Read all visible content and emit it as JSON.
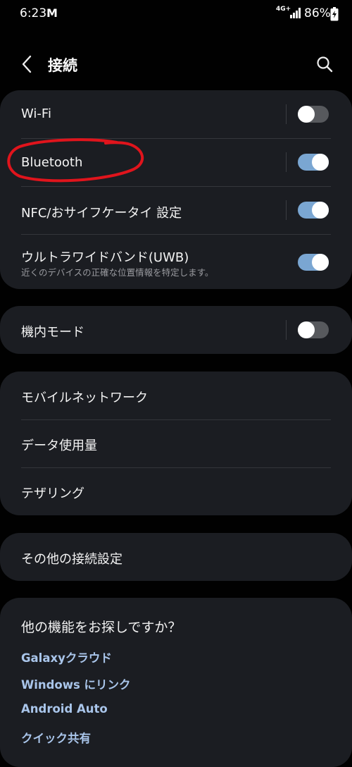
{
  "status_bar": {
    "time": "6:23",
    "mail_icon": "gmail-icon",
    "network": "4G+",
    "battery_percent": "86%",
    "battery_level": 0.86
  },
  "header": {
    "title": "接続"
  },
  "connections": {
    "wifi": {
      "label": "Wi-Fi",
      "enabled": false
    },
    "bluetooth": {
      "label": "Bluetooth",
      "enabled": true
    },
    "nfc": {
      "label": "NFC/おサイフケータイ 設定",
      "enabled": true
    },
    "uwb": {
      "label": "ウルトラワイドバンド(UWB)",
      "subtitle": "近くのデバイスの正確な位置情報を特定します。",
      "enabled": true
    }
  },
  "airplane": {
    "label": "機内モード",
    "enabled": false
  },
  "network_group": [
    {
      "label": "モバイルネットワーク"
    },
    {
      "label": "データ使用量"
    },
    {
      "label": "テザリング"
    }
  ],
  "more": {
    "label": "その他の接続設定"
  },
  "suggestions": {
    "title": "他の機能をお探しですか？",
    "links": [
      {
        "label": "Galaxyクラウド"
      },
      {
        "label": "Windows にリンク"
      },
      {
        "label": "Android Auto"
      },
      {
        "label": "クイック共有"
      }
    ]
  },
  "colors": {
    "background": "#010101",
    "card": "#1b1d22",
    "toggle_on": "#7aa6d2",
    "toggle_off": "#57595d",
    "link": "#a9c5ea",
    "annotation": "#e0141c"
  }
}
